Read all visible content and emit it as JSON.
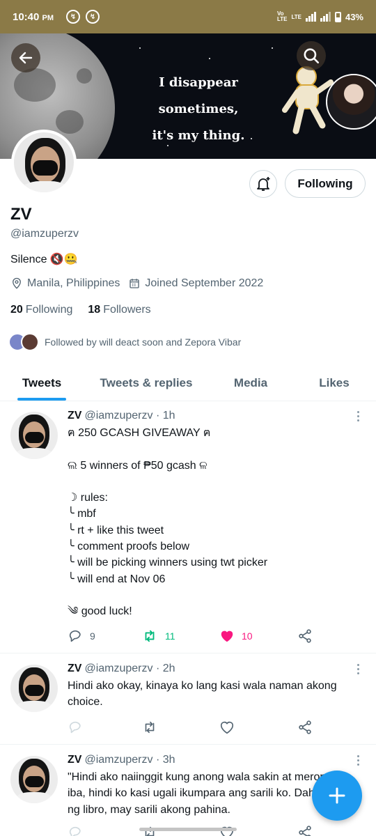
{
  "statusbar": {
    "time": "10:40",
    "ampm": "PM",
    "net1": "Vo\nLTE",
    "net2": "LTE",
    "battery": "43%"
  },
  "banner": {
    "line1": "I disappear sometimes,",
    "line2": "it's my thing."
  },
  "profile": {
    "name": "ZV",
    "handle": "@iamzuperzv",
    "bio": "Silence 🔇🤐",
    "location": "Manila, Philippines",
    "joined": "Joined September 2022",
    "following_count": "20",
    "following_label": "Following",
    "followers_count": "18",
    "followers_label": "Followers",
    "followed_by": "Followed by will deact soon and Zepora Vibar",
    "follow_button": "Following"
  },
  "tabs": [
    "Tweets",
    "Tweets & replies",
    "Media",
    "Likes"
  ],
  "tweets": [
    {
      "name": "ZV",
      "handle": "@iamzuperzv",
      "time": "· 1h",
      "text": "ฅ 250 GCASH GIVEAWAY ฅ\n\nଲ 5 winners of ₱50 gcash ଳ\n\n☽ rules:\n╰  mbf\n╰  rt + like this tweet\n╰  comment proofs below\n╰  will be picking winners using twt picker\n╰ will end at Nov 06\n\n༄ good luck!",
      "replies": "9",
      "retweets": "11",
      "likes": "10"
    },
    {
      "name": "ZV",
      "handle": "@iamzuperzv",
      "time": "· 2h",
      "text": "Hindi ako okay, kinaya ko lang kasi wala naman akong choice."
    },
    {
      "name": "ZV",
      "handle": "@iamzuperzv",
      "time": "· 3h",
      "text": "\"Hindi ako naiinggit kung anong wala sakin at meron ang iba, hindi ko kasi ugali ikumpara ang sarili ko. Dahil tulad ng libro, may sarili akong pahina."
    }
  ],
  "colors": {
    "accent": "#1d9bf0",
    "retweet": "#00ba7c",
    "like": "#f91880",
    "statusbar": "#8b7a47"
  }
}
